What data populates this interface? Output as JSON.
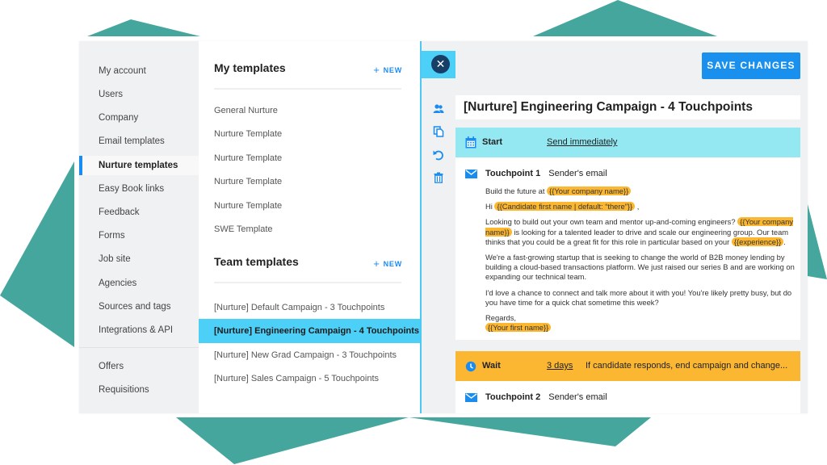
{
  "colors": {
    "accent_blue": "#1a90ee",
    "selected_cyan": "#4dd0f8",
    "start_bar": "#94e8f2",
    "wait_bar": "#fbb731",
    "variable_highlight": "#fbb731",
    "close_button": "#163e66",
    "background_shape": "#45a69e",
    "panel_gray": "#f0f1f3"
  },
  "settings_nav": {
    "items": [
      {
        "label": "My account"
      },
      {
        "label": "Users"
      },
      {
        "label": "Company"
      },
      {
        "label": "Email templates"
      },
      {
        "label": "Nurture templates",
        "active": true
      },
      {
        "label": "Easy Book links"
      },
      {
        "label": "Feedback"
      },
      {
        "label": "Forms"
      },
      {
        "label": "Job site"
      },
      {
        "label": "Agencies"
      },
      {
        "label": "Sources and tags"
      },
      {
        "label": "Integrations & API"
      }
    ],
    "secondary_items": [
      {
        "label": "Offers"
      },
      {
        "label": "Requisitions"
      }
    ]
  },
  "my_templates": {
    "title": "My templates",
    "new_label": "NEW",
    "items": [
      "General Nurture",
      "Nurture Template",
      "Nurture Template",
      "Nurture Template",
      "Nurture Template",
      "SWE Template"
    ]
  },
  "team_templates": {
    "title": "Team templates",
    "new_label": "NEW",
    "items": [
      "[Nurture] Default Campaign - 3 Touchpoints",
      "[Nurture] Engineering Campaign - 4 Touchpoints",
      "[Nurture] New Grad Campaign - 3 Touchpoints",
      "[Nurture] Sales Campaign - 5 Touchpoints"
    ],
    "selected_index": 1
  },
  "editor": {
    "close_icon": "close-icon",
    "save_label": "SAVE CHANGES",
    "tools": [
      "users-icon",
      "copy-icon",
      "undo-icon",
      "trash-icon"
    ],
    "campaign_title": "[Nurture] Engineering Campaign - 4 Touchpoints",
    "start": {
      "label": "Start",
      "value": "Send immediately"
    },
    "touchpoint1": {
      "label": "Touchpoint 1",
      "sender": "Sender's email",
      "subject_prefix": "Build the future at ",
      "subject_var": "{{Your company name}}",
      "greeting_prefix": "Hi ",
      "greeting_var": "{{Candidate first name | default: “there”}}",
      "greeting_suffix": " ,",
      "p1_a": "Looking to build out your own team and mentor up-and-coming engineers? ",
      "p1_var1": "{{Your company name}}",
      "p1_b": " is looking for a talented leader to drive and scale our engineering group. Our team thinks that you could be a great fit for this role in particular based on your ",
      "p1_var2": "{{experience}}",
      "p1_c": ".",
      "p2": "We're a fast-growing startup that is seeking to change the world of B2B money lending by building a cloud-based transactions platform. We just raised our series B and are working on expanding our technical team.",
      "p3": "I'd love a chance to connect and talk more about it with you! You're likely pretty busy, but do you have time for a quick chat sometime this week?",
      "signoff": "Regards,",
      "signature_var": "{{Your first name}}"
    },
    "wait": {
      "label": "Wait",
      "duration": "3 days",
      "condition": "If candidate responds, end campaign and change..."
    },
    "touchpoint2": {
      "label": "Touchpoint 2",
      "sender": "Sender's email"
    }
  }
}
